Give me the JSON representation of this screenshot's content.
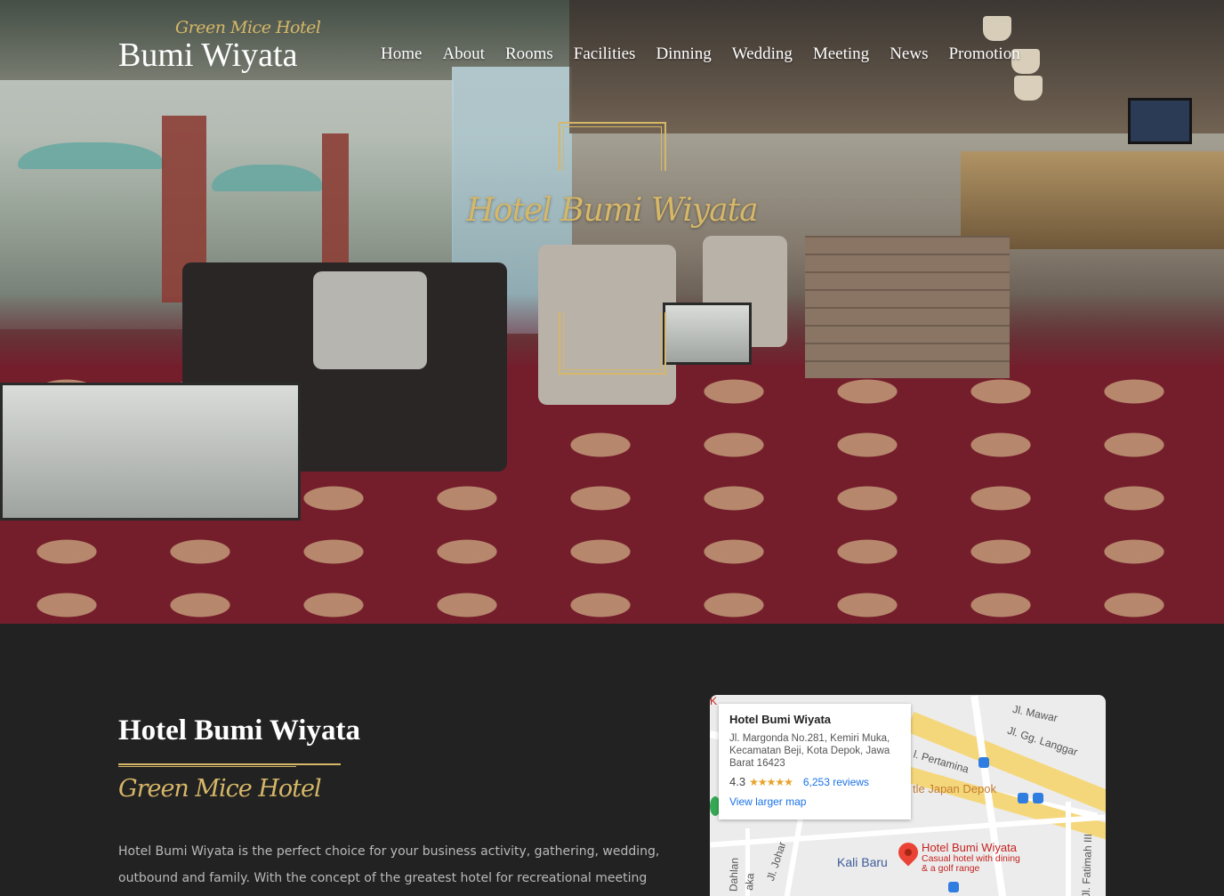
{
  "header": {
    "brand_script": "Green Mice Hotel",
    "brand_name": "Bumi Wiyata",
    "nav": [
      "Home",
      "About",
      "Rooms",
      "Facilities",
      "Dinning",
      "Wedding",
      "Meeting",
      "News",
      "Promotion"
    ]
  },
  "hero": {
    "title": "Hotel Bumi Wiyata"
  },
  "about": {
    "title": "Hotel Bumi Wiyata",
    "subtitle": "Green Mice Hotel",
    "text": "Hotel Bumi Wiyata is the perfect choice for your business activity, gathering, wedding, outbound and family. With the concept of the greatest hotel for recreational meeting surrounding with"
  },
  "map": {
    "card_title": "Hotel Bumi Wiyata",
    "card_address": "Jl. Margonda No.281, Kemiri Muka, Kecamatan Beji, Kota Depok, Jawa Barat 16423",
    "rating": "4.3",
    "stars": "★★★★★",
    "reviews": "6,253 reviews",
    "larger_map": "View larger map",
    "pin_title": "Hotel Bumi Wiyata",
    "pin_desc": "Casual hotel with dining & a golf range",
    "area_label": "Kali Baru",
    "poi": "tle Japan Depok",
    "street_mawar": "Jl. Mawar",
    "street_langgar": "Jl. Gg. Langgar",
    "street_pertamina": "l. Pertamina",
    "street_johar": "Jl. Johar",
    "street_dahlan": "Dahlan",
    "street_fatimah": "Jl. Fatimah III",
    "street_aka": "aka",
    "corner_k": "K"
  },
  "colors": {
    "gold": "#d6b768",
    "dark_bg": "#222222"
  }
}
